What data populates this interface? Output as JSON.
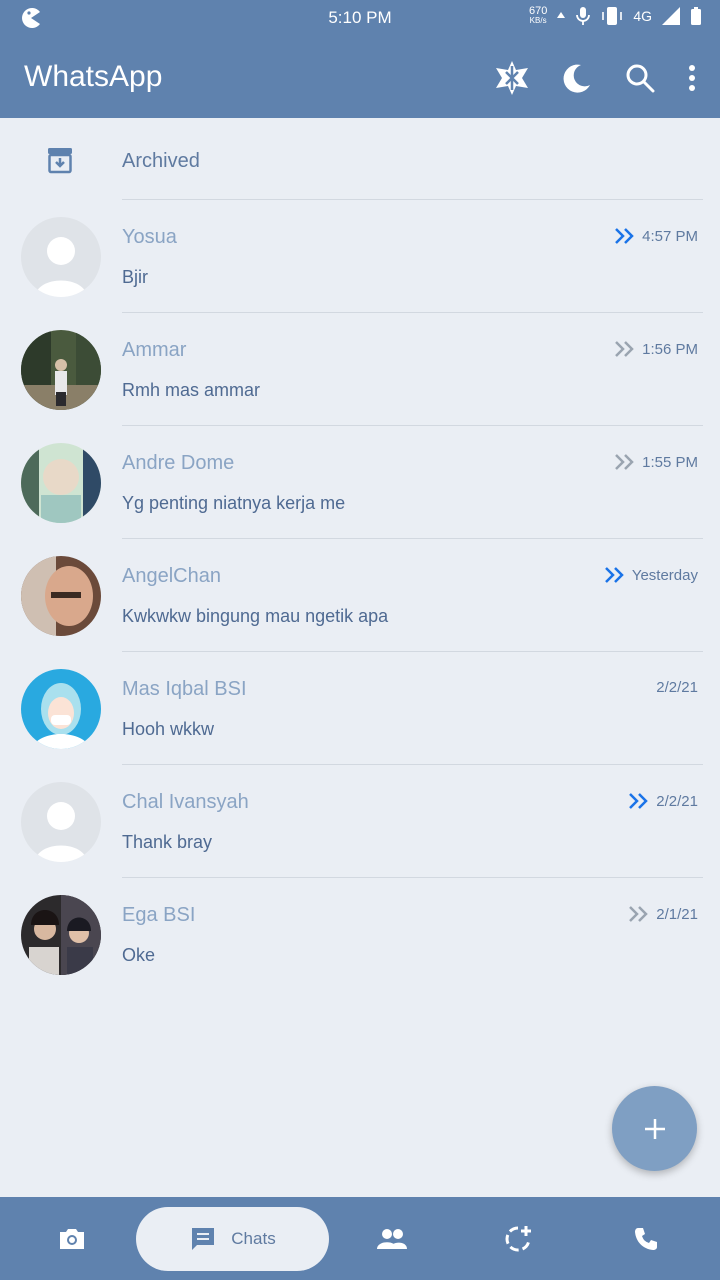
{
  "status_bar": {
    "time": "5:10 PM",
    "net_speed": "670",
    "net_unit": "KB/s",
    "network": "4G"
  },
  "header": {
    "title": "WhatsApp",
    "icons": [
      "airplane-mode-icon",
      "moon-icon",
      "search-icon",
      "more-vert-icon"
    ]
  },
  "archived": {
    "label": "Archived"
  },
  "chats": [
    {
      "name": "Yosua",
      "message": "Bjir",
      "time": "4:57 PM",
      "tick": "read",
      "avatar": "default"
    },
    {
      "name": "Ammar",
      "message": "Rmh mas ammar",
      "time": "1:56 PM",
      "tick": "delivered",
      "avatar": "photo-forest"
    },
    {
      "name": "Andre Dome",
      "message": "Yg penting niatnya kerja me",
      "time": "1:55 PM",
      "tick": "delivered",
      "avatar": "photo-child"
    },
    {
      "name": "AngelChan",
      "message": "Kwkwkw bingung mau ngetik apa",
      "time": "Yesterday",
      "tick": "read",
      "avatar": "photo-face"
    },
    {
      "name": "Mas Iqbal BSI",
      "message": "Hooh wkkw",
      "time": "2/2/21",
      "tick": "none",
      "avatar": "illustration-mask"
    },
    {
      "name": "Chal Ivansyah",
      "message": "Thank bray",
      "time": "2/2/21",
      "tick": "read",
      "avatar": "default"
    },
    {
      "name": "Ega BSI",
      "message": "Oke",
      "time": "2/1/21",
      "tick": "delivered",
      "avatar": "photo-couple"
    }
  ],
  "bottom_nav": {
    "chats_label": "Chats",
    "items": [
      "camera-icon",
      "chats-icon",
      "people-icon",
      "status-add-icon",
      "phone-icon"
    ]
  },
  "colors": {
    "primary": "#5f82ae",
    "background": "#eaeef4",
    "read_tick": "#1a73e8",
    "delivered_tick": "#9aa4b0",
    "fab": "#7f9fc3"
  }
}
